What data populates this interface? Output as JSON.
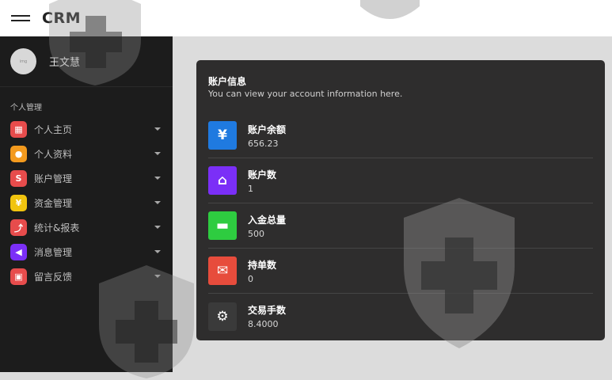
{
  "app": {
    "brand": "CRM"
  },
  "user": {
    "name": "王文慧",
    "avatar_text": "img"
  },
  "sidebar": {
    "section_title": "个人管理",
    "items": [
      {
        "label": "个人主页",
        "icon": "grid-icon",
        "color": "#e74c4c",
        "glyph": "▦"
      },
      {
        "label": "个人资料",
        "icon": "profile-icon",
        "color": "#f39a1e",
        "glyph": "●"
      },
      {
        "label": "账户管理",
        "icon": "account-icon",
        "color": "#e74c4c",
        "glyph": "S"
      },
      {
        "label": "资金管理",
        "icon": "yen-icon",
        "color": "#f1c40f",
        "glyph": "¥"
      },
      {
        "label": "统计&报表",
        "icon": "chart-icon",
        "color": "#e74c4c",
        "glyph": "⤴"
      },
      {
        "label": "消息管理",
        "icon": "megaphone-icon",
        "color": "#7b2ff7",
        "glyph": "◀"
      },
      {
        "label": "留言反馈",
        "icon": "feedback-icon",
        "color": "#e74c4c",
        "glyph": "▣"
      }
    ]
  },
  "account_card": {
    "title": "账户信息",
    "subtitle": "You can view your account information here.",
    "rows": [
      {
        "label": "账户余额",
        "value": "656.23",
        "icon": "yen-icon",
        "color": "#1f7ae0",
        "glyph": "¥"
      },
      {
        "label": "账户数",
        "value": "1",
        "icon": "store-icon",
        "color": "#7b2ff7",
        "glyph": "⌂"
      },
      {
        "label": "入金总量",
        "value": "500",
        "icon": "card-icon",
        "color": "#2ecc40",
        "glyph": "▬"
      },
      {
        "label": "持单数",
        "value": "0",
        "icon": "chat-icon",
        "color": "#e74c3c",
        "glyph": "✉"
      },
      {
        "label": "交易手数",
        "value": "8.4000",
        "icon": "gear-icon",
        "color": "#3a3a3a",
        "glyph": "⚙"
      }
    ]
  }
}
